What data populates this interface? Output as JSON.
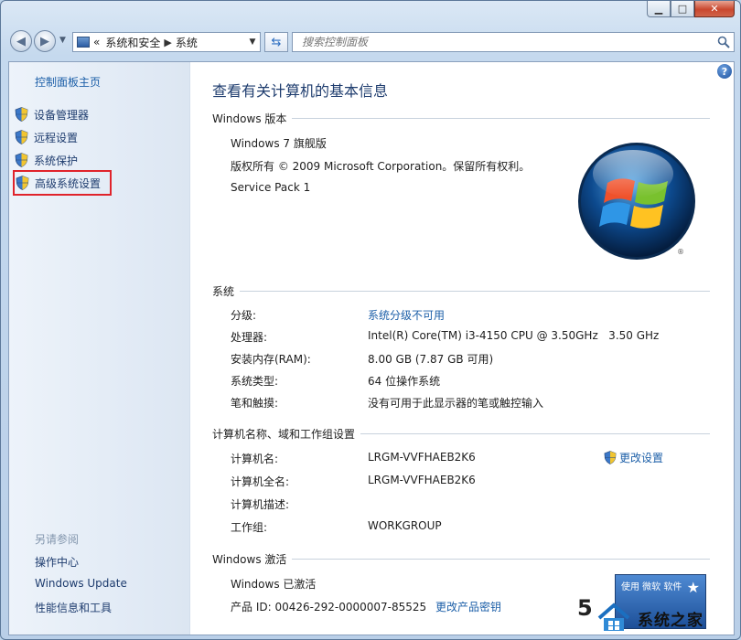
{
  "breadcrumb": {
    "prefix": "«",
    "items": [
      "系统和安全",
      "系统"
    ]
  },
  "search": {
    "placeholder": "搜索控制面板"
  },
  "sidebar": {
    "home": "控制面板主页",
    "items": [
      {
        "label": "设备管理器"
      },
      {
        "label": "远程设置"
      },
      {
        "label": "系统保护"
      },
      {
        "label": "高级系统设置"
      }
    ],
    "see_also_title": "另请参阅",
    "see_also": [
      "操作中心",
      "Windows Update",
      "性能信息和工具"
    ]
  },
  "main": {
    "title": "查看有关计算机的基本信息",
    "edition": {
      "heading": "Windows 版本",
      "name": "Windows 7 旗舰版",
      "copyright": "版权所有 © 2009 Microsoft Corporation。保留所有权利。",
      "service_pack": "Service Pack 1"
    },
    "system": {
      "heading": "系统",
      "rows": [
        {
          "label": "分级:",
          "value": "系统分级不可用",
          "link": true
        },
        {
          "label": "处理器:",
          "value": "Intel(R) Core(TM) i3-4150 CPU @ 3.50GHz   3.50 GHz"
        },
        {
          "label": "安装内存(RAM):",
          "value": "8.00 GB (7.87 GB 可用)"
        },
        {
          "label": "系统类型:",
          "value": "64 位操作系统"
        },
        {
          "label": "笔和触摸:",
          "value": "没有可用于此显示器的笔或触控输入"
        }
      ]
    },
    "computer": {
      "heading": "计算机名称、域和工作组设置",
      "change_settings": "更改设置",
      "rows": [
        {
          "label": "计算机名:",
          "value": "LRGM-VVFHAEB2K6"
        },
        {
          "label": "计算机全名:",
          "value": "LRGM-VVFHAEB2K6"
        },
        {
          "label": "计算机描述:",
          "value": ""
        },
        {
          "label": "工作组:",
          "value": "WORKGROUP"
        }
      ]
    },
    "activation": {
      "heading": "Windows 激活",
      "status": "Windows 已激活",
      "product_id_label": "产品 ID: 00426-292-0000007-85525",
      "change_key": "更改产品密钥",
      "badge_text": "使用 微软 软件"
    }
  },
  "watermark": {
    "digit": "5",
    "text": "系统之家"
  }
}
